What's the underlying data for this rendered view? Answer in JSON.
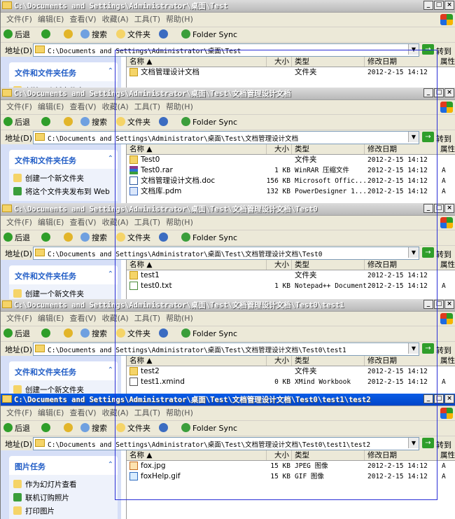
{
  "menu": [
    "文件(F)",
    "编辑(E)",
    "查看(V)",
    "收藏(A)",
    "工具(T)",
    "帮助(H)"
  ],
  "toolbar": {
    "back": "后退",
    "search": "搜索",
    "folders": "文件夹",
    "folder_sync": "Folder Sync"
  },
  "address_label": "地址(D)",
  "go_label": "转到",
  "columns": {
    "name": "名称 ▲",
    "size": "大小",
    "type": "类型",
    "modified": "修改日期",
    "attr": "属性"
  },
  "windows": [
    {
      "title": "C:\\Documents and Settings\\Administrator\\桌面\\Test",
      "address": "C:\\Documents and Settings\\Administrator\\桌面\\Test",
      "task_title": "文件和文件夹任务",
      "tasks": [
        "创建一个新文件夹"
      ],
      "files": [
        {
          "name": "文档管理设计文档",
          "size": "",
          "type": "文件夹",
          "modified": "2012-2-15 14:12",
          "attr": "",
          "icon": "folder"
        }
      ]
    },
    {
      "title": "C:\\Documents and Settings\\Administrator\\桌面\\Test\\文档管理设计文档",
      "address": "C:\\Documents and Settings\\Administrator\\桌面\\Test\\文档管理设计文档",
      "task_title": "文件和文件夹任务",
      "tasks": [
        "创建一个新文件夹",
        "将这个文件夹发布到 Web"
      ],
      "files": [
        {
          "name": "Test0",
          "size": "",
          "type": "文件夹",
          "modified": "2012-2-15 14:12",
          "attr": "",
          "icon": "folder"
        },
        {
          "name": "Test0.rar",
          "size": "1 KB",
          "type": "WinRAR 压缩文件",
          "modified": "2012-2-15 14:12",
          "attr": "A",
          "icon": "rar"
        },
        {
          "name": "文档管理设计文档.doc",
          "size": "156 KB",
          "type": "Microsoft Offic...",
          "modified": "2012-2-15 14:12",
          "attr": "A",
          "icon": "doc"
        },
        {
          "name": "文档库.pdm",
          "size": "132 KB",
          "type": "PowerDesigner 1...",
          "modified": "2012-2-15 14:12",
          "attr": "A",
          "icon": "pdm"
        }
      ]
    },
    {
      "title": "C:\\Documents and Settings\\Administrator\\桌面\\Test\\文档管理设计文档\\Test0",
      "address": "C:\\Documents and Settings\\Administrator\\桌面\\Test\\文档管理设计文档\\Test0",
      "task_title": "文件和文件夹任务",
      "tasks": [
        "创建一个新文件夹"
      ],
      "files": [
        {
          "name": "test1",
          "size": "",
          "type": "文件夹",
          "modified": "2012-2-15 14:12",
          "attr": "",
          "icon": "folder"
        },
        {
          "name": "test0.txt",
          "size": "1 KB",
          "type": "Notepad++ Document",
          "modified": "2012-2-15 14:12",
          "attr": "A",
          "icon": "txt"
        }
      ]
    },
    {
      "title": "C:\\Documents and Settings\\Administrator\\桌面\\Test\\文档管理设计文档\\Test0\\test1",
      "address": "C:\\Documents and Settings\\Administrator\\桌面\\Test\\文档管理设计文档\\Test0\\test1",
      "task_title": "文件和文件夹任务",
      "tasks": [
        "创建一个新文件夹"
      ],
      "files": [
        {
          "name": "test2",
          "size": "",
          "type": "文件夹",
          "modified": "2012-2-15 14:12",
          "attr": "",
          "icon": "folder"
        },
        {
          "name": "test1.xmind",
          "size": "0 KB",
          "type": "XMind Workbook",
          "modified": "2012-2-15 14:12",
          "attr": "A",
          "icon": "xmind"
        }
      ]
    },
    {
      "title": "C:\\Documents and Settings\\Administrator\\桌面\\Test\\文档管理设计文档\\Test0\\test1\\test2",
      "address": "C:\\Documents and Settings\\Administrator\\桌面\\Test\\文档管理设计文档\\Test0\\test1\\test2",
      "task_title": "图片任务",
      "tasks": [
        "作为幻灯片查看",
        "联机订购照片",
        "打印图片"
      ],
      "files": [
        {
          "name": "fox.jpg",
          "size": "15 KB",
          "type": "JPEG 图像",
          "modified": "2012-2-15 14:12",
          "attr": "A",
          "icon": "jpg"
        },
        {
          "name": "foxHelp.gif",
          "size": "15 KB",
          "type": "GIF 图像",
          "modified": "2012-2-15 14:12",
          "attr": "A",
          "icon": "gif"
        }
      ]
    }
  ]
}
